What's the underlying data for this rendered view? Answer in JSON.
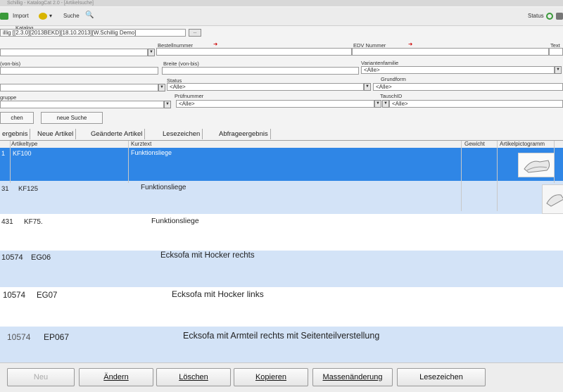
{
  "window": {
    "title": "Schillig - KatalogCat 2.0 - [Artikelsuche]"
  },
  "toolbar": {
    "import_label": "Import",
    "search_label": "Suche",
    "status_label": "Status",
    "catalog_label": "Katalog",
    "catalog_value": "illig [[2.3.0][2013BEKD][18.10.2013][W.Schillig Demo]",
    "catalog_button": "..."
  },
  "filters": {
    "bestellnummer_label": "Bestellnummer",
    "edv_label": "EDV Nummer",
    "text_label": "Text",
    "von_bis_label": "(von-bis)",
    "breite_label": "Breite (von-bis)",
    "variantenfamilie_label": "Variantenfamilie",
    "variantenfamilie_value": "<Alle>",
    "status_label": "Status",
    "status_value": "<Alle>",
    "grundform_label": "Grundform",
    "grundform_value": "<Alle>",
    "gruppe_label": "gruppe",
    "pruefnummer_label": "Prüfnummer",
    "pruefnummer_value": "<Alle>",
    "tauschid_label": "TauschID",
    "tauschid_value": "<Alle>",
    "search_button": "chen",
    "new_search_button": "neue Suche"
  },
  "tabs": [
    {
      "label": "ergebnis"
    },
    {
      "label": "Neue Artikel"
    },
    {
      "label": "Geänderte Artikel"
    },
    {
      "label": "Lesezeichen"
    },
    {
      "label": "Abfrageergebnis"
    }
  ],
  "grid": {
    "columns": [
      "Artikeltype",
      "Kurztext",
      "Gewicht",
      "Artikelpictogramm"
    ],
    "rows": [
      {
        "id": "1",
        "type": "KF100",
        "text": "Funktionsliege",
        "selected": true,
        "pictogram": "chair-icon"
      },
      {
        "id": "31",
        "type": "KF125",
        "text": "Funktionsliege",
        "selected": false,
        "pictogram": "chair-icon"
      },
      {
        "id": "431",
        "type": "KF75.",
        "text": "Funktionsliege",
        "selected": false
      },
      {
        "id": "10574",
        "type": "EG06",
        "text": "Ecksofa mit Hocker rechts",
        "selected": false
      },
      {
        "id": "10574",
        "type": "EG07",
        "text": "Ecksofa mit Hocker links",
        "selected": false
      },
      {
        "id": "10574",
        "type": "EP067",
        "text": "Ecksofa mit Armteil rechts mit Seitenteilverstellung",
        "selected": false
      }
    ]
  },
  "buttons": {
    "neu": "Neu",
    "aendern": "Ändern",
    "loeschen": "Löschen",
    "kopieren": "Kopieren",
    "massenaenderung": "Massenänderung",
    "lesezeichen": "Lesezeichen"
  },
  "colors": {
    "selected_row": "#2f86e6",
    "alt_row": "#d3e3f7",
    "plain_row": "#ffffff"
  }
}
